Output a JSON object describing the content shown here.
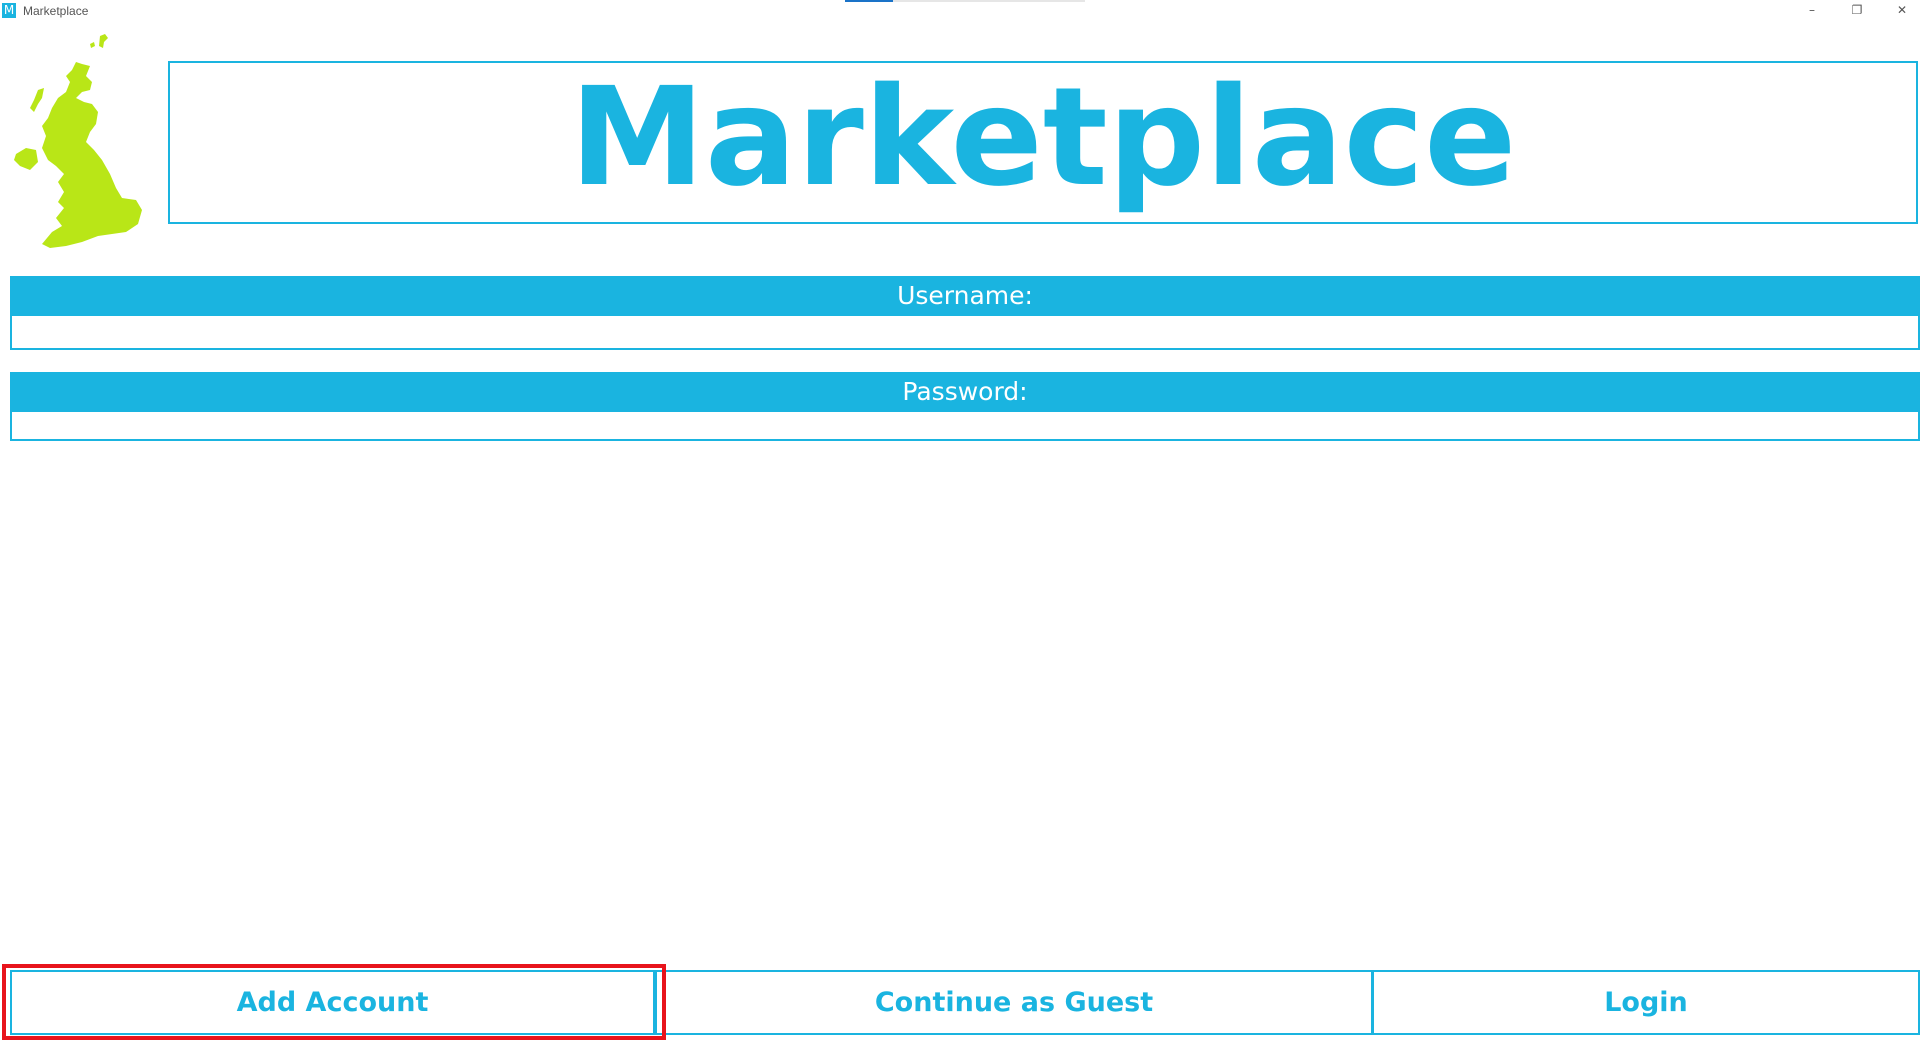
{
  "window": {
    "icon_letter": "M",
    "title": "Marketplace",
    "controls": {
      "minimize": "–",
      "restore": "❐",
      "close": "✕"
    }
  },
  "header": {
    "logo_icon": "uk-map-icon",
    "logo_color": "#b9e617",
    "title": "Marketplace"
  },
  "form": {
    "username_label": "Username:",
    "username_value": "",
    "password_label": "Password:",
    "password_value": ""
  },
  "actions": {
    "add_account": "Add Account",
    "continue_guest": "Continue as Guest",
    "login": "Login"
  },
  "colors": {
    "accent": "#1ab4e0",
    "highlight": "#e8141c",
    "logo": "#b9e617"
  }
}
